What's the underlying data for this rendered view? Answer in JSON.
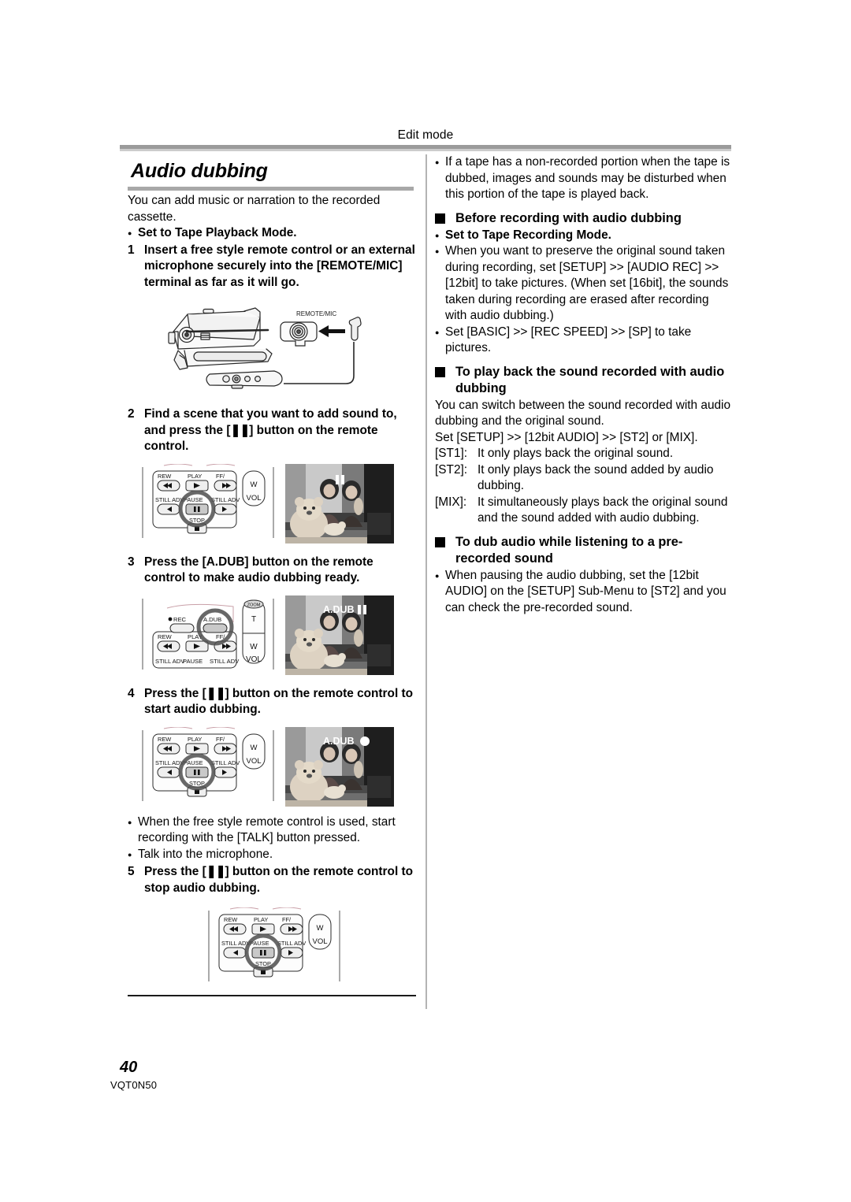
{
  "running_head": "Edit mode",
  "section": {
    "title": "Audio dubbing",
    "intro": "You can add music or narration to the recorded cassette.",
    "precondition": "Set to Tape Playback Mode."
  },
  "steps": [
    {
      "num": "1",
      "text": "Insert a free style remote control or an external microphone securely into the [REMOTE/MIC] terminal as far as it will go."
    },
    {
      "num": "2",
      "text_before": "Find a scene that you want to add sound to, and press the [",
      "glyph": "❚❚",
      "text_after": "] button on the remote control."
    },
    {
      "num": "3",
      "text": "Press the [A.DUB] button on the remote control to make audio dubbing ready."
    },
    {
      "num": "4",
      "text_before": "Press the [",
      "glyph": "❚❚",
      "text_after": "] button on the remote control to start audio dubbing."
    },
    {
      "num": "5",
      "text_before": "Press the [",
      "glyph": "❚❚",
      "text_after": "] button on the remote control to stop audio dubbing."
    }
  ],
  "figures": {
    "camera": {
      "terminal_label": "REMOTE/MIC"
    },
    "remote_labels": {
      "rew": "REW",
      "play": "PLAY",
      "ff": "FF/",
      "still_adv_left": "STILL ADV",
      "pause": "PAUSE",
      "still_adv_right": "STILL ADV",
      "stop": "STOP",
      "w": "W",
      "t": "T",
      "vol": "VOL",
      "zoom": "ZOOM",
      "rec": "REC",
      "adub": "A.DUB"
    },
    "video_osd": {
      "step3": "A.DUB",
      "step4": "A.DUB"
    }
  },
  "notes_after_step4": [
    "When the free style remote control is used, start recording with the [TALK] button pressed.",
    "Talk into the microphone."
  ],
  "right_column": {
    "first_note": "If a tape has a non-recorded portion when the tape is dubbed, images and sounds may be disturbed when this portion of the tape is played back.",
    "head1": "Before recording with audio dubbing",
    "head1_bullets": [
      "Set to Tape Recording Mode.",
      "When you want to preserve the original sound taken during recording, set [SETUP] >> [AUDIO REC] >> [12bit] to take pictures. (When set [16bit], the sounds taken during recording are erased after recording with audio dubbing.)",
      "Set [BASIC] >> [REC SPEED] >> [SP] to take pictures."
    ],
    "head2": "To play back the sound recorded with audio dubbing",
    "head2_body": "You can switch between the sound recorded with audio dubbing and the original sound.",
    "head2_setting": "Set [SETUP] >> [12bit AUDIO] >> [ST2] or [MIX].",
    "modes": [
      {
        "key": "[ST1]:",
        "desc": "It only plays back the original sound."
      },
      {
        "key": "[ST2]:",
        "desc": "It only plays back the sound added by audio dubbing."
      },
      {
        "key": "[MIX]:",
        "desc": "It simultaneously plays back the original sound and the sound added with audio dubbing."
      }
    ],
    "head3": "To dub audio while listening to a pre-recorded sound",
    "head3_bullet": "When pausing the audio  dubbing, set the [12bit AUDIO] on the [SETUP] Sub-Menu to [ST2] and you can check the pre-recorded sound."
  },
  "footer": {
    "page_number": "40",
    "part_number": "VQT0N50"
  }
}
